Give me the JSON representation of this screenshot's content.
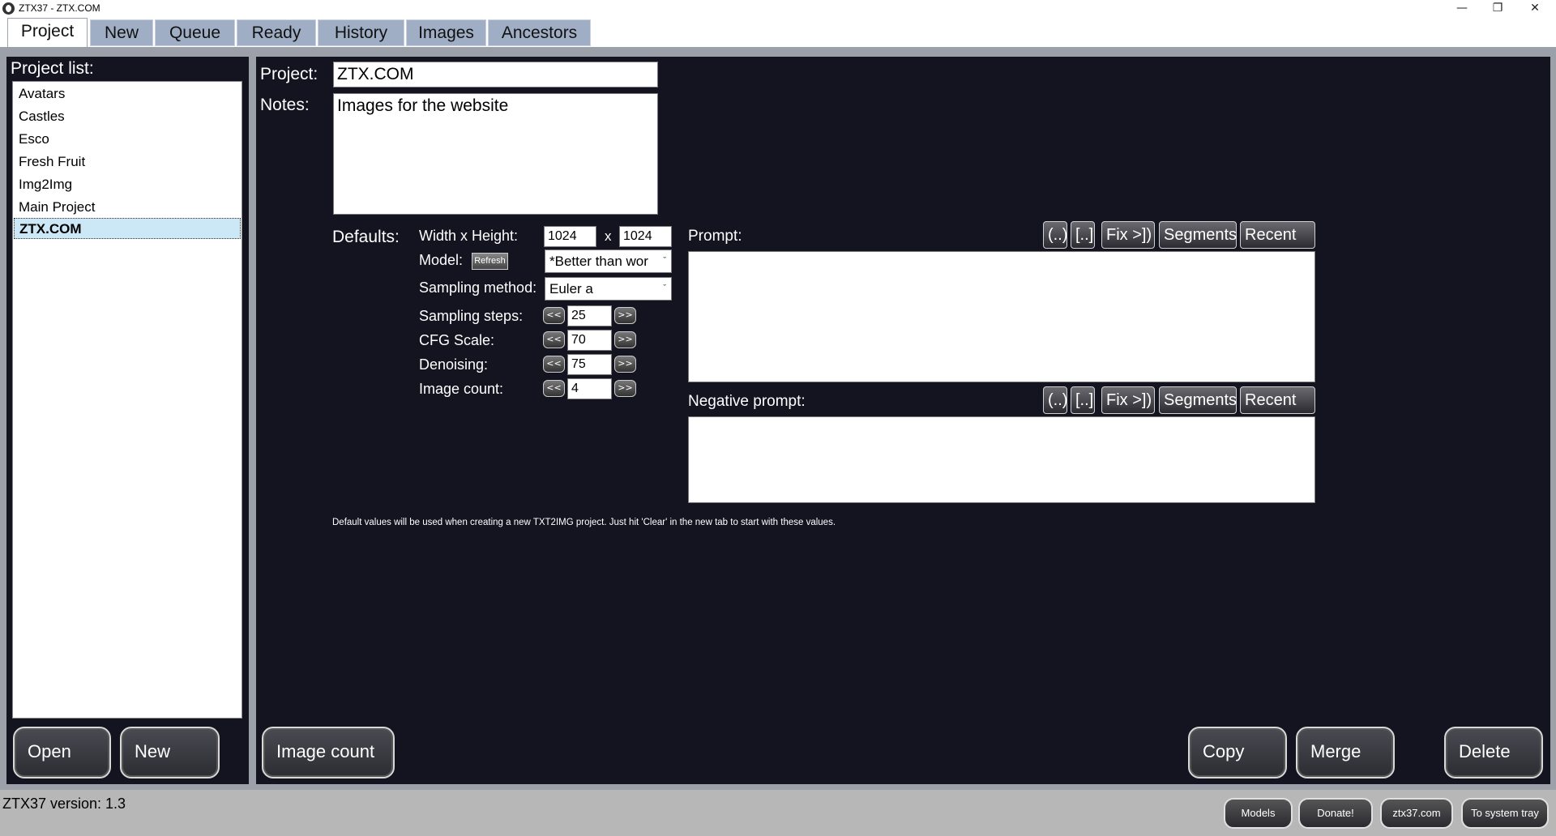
{
  "window": {
    "title": "ZTX37 - ZTX.COM",
    "controls": [
      "minimize",
      "restore",
      "close"
    ]
  },
  "tabs": [
    {
      "label": "Project",
      "active": true
    },
    {
      "label": "New"
    },
    {
      "label": "Queue"
    },
    {
      "label": "Ready"
    },
    {
      "label": "History"
    },
    {
      "label": "Images"
    },
    {
      "label": "Ancestors"
    }
  ],
  "sidebar": {
    "title": "Project list:",
    "items": [
      "Avatars",
      "Castles",
      "Esco",
      "Fresh Fruit",
      "Img2Img",
      "Main Project",
      "ZTX.COM"
    ],
    "selected": "ZTX.COM",
    "open_label": "Open",
    "new_label": "New"
  },
  "project": {
    "project_label": "Project:",
    "project_value": "ZTX.COM",
    "notes_label": "Notes:",
    "notes_value": "Images for the website"
  },
  "defaults": {
    "label": "Defaults:",
    "size_label": "Width x Height:",
    "width": "1024",
    "x_sep": "x",
    "height": "1024",
    "model_label": "Model:",
    "refresh_label": "Refresh",
    "model_value": "*Better than wor",
    "sampling_method_label": "Sampling method:",
    "sampling_method_value": "Euler a",
    "sampling_steps_label": "Sampling steps:",
    "sampling_steps_value": "25",
    "cfg_label": "CFG Scale:",
    "cfg_value": "70",
    "denoising_label": "Denoising:",
    "denoising_value": "75",
    "image_count_label": "Image count:",
    "image_count_value": "4",
    "dec_label": "<<",
    "inc_label": ">>",
    "note": "Default values will be used when creating a new TXT2IMG project. Just hit 'Clear' in the new tab to start with these values."
  },
  "prompt": {
    "label": "Prompt:",
    "value": "",
    "buttons": [
      "(..)",
      "[..]",
      "Fix >])",
      "Segments",
      "Recent"
    ]
  },
  "negative_prompt": {
    "label": "Negative prompt:",
    "value": "",
    "buttons": [
      "(..)",
      "[..]",
      "Fix >])",
      "Segments",
      "Recent"
    ]
  },
  "actions": {
    "image_count": "Image count",
    "copy": "Copy",
    "merge": "Merge",
    "delete": "Delete"
  },
  "status": {
    "version": "ZTX37 version: 1.3",
    "buttons": [
      "Models",
      "Donate!",
      "ztx37.com",
      "To system tray"
    ]
  }
}
